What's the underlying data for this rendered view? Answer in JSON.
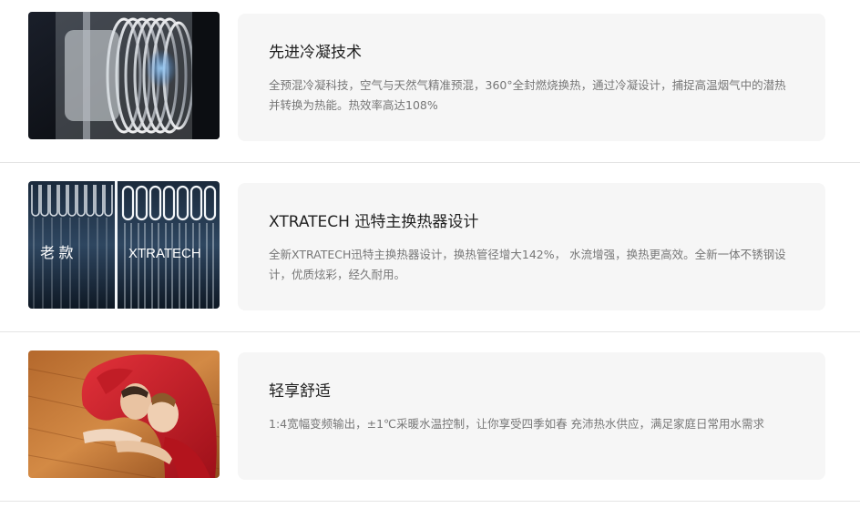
{
  "features": [
    {
      "image_icon": "condenser-heat-exchanger-photo",
      "title": "先进冷凝技术",
      "description": "全预混冷凝科技，空气与天然气精准预混，360°全封燃烧换热，通过冷凝设计，捕捉高温烟气中的潜热并转换为热能。热效率高达108%"
    },
    {
      "image_icon": "heat-exchanger-comparison-photo",
      "image_label_old": "老 款",
      "image_label_new": "XTRATECH",
      "title": "XTRATECH 迅特主换热器设计",
      "description": "全新XTRATECH迅特主换热器设计，换热管径增大142%， 水流增强，换热更高效。全新一体不锈钢设计，优质炫彩，经久耐用。"
    },
    {
      "image_icon": "couple-under-blanket-photo",
      "title": "轻享舒适",
      "description": "1:4宽幅变频输出，±1℃采暖水温控制，让你享受四季如春 充沛热水供应，满足家庭日常用水需求"
    }
  ]
}
